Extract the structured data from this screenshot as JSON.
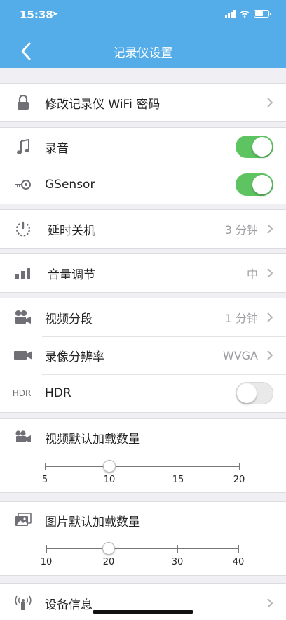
{
  "status": {
    "time": "15:38",
    "location_glyph": "➤"
  },
  "nav": {
    "title": "记录仪设置"
  },
  "items": {
    "wifi_password": {
      "label": "修改记录仪 WiFi 密码",
      "icon": "lock-icon"
    },
    "recording": {
      "label": "录音",
      "icon": "music-note-icon",
      "on": true
    },
    "gsensor": {
      "label": "GSensor",
      "icon": "sensor-key-icon",
      "on": true
    },
    "auto_off": {
      "label": "延时关机",
      "value": "3 分钟",
      "icon": "power-timer-icon"
    },
    "volume": {
      "label": "音量调节",
      "value": "中",
      "icon": "volume-bars-icon"
    },
    "segment": {
      "label": "视频分段",
      "value": "1 分钟",
      "icon": "video-segment-icon"
    },
    "resolution": {
      "label": "录像分辨率",
      "value": "WVGA",
      "icon": "video-camera-icon"
    },
    "hdr": {
      "label": "HDR",
      "icon_text": "HDR",
      "on": false
    },
    "video_load": {
      "label": "视频默认加载数量",
      "ticks": [
        "5",
        "10",
        "15",
        "20"
      ],
      "selected": "10",
      "icon": "movie-camera-icon"
    },
    "photo_load": {
      "label": "图片默认加载数量",
      "ticks": [
        "10",
        "20",
        "30",
        "40"
      ],
      "selected": "20",
      "icon": "picture-icon"
    },
    "device_info": {
      "label": "设备信息",
      "icon": "antenna-icon"
    }
  }
}
